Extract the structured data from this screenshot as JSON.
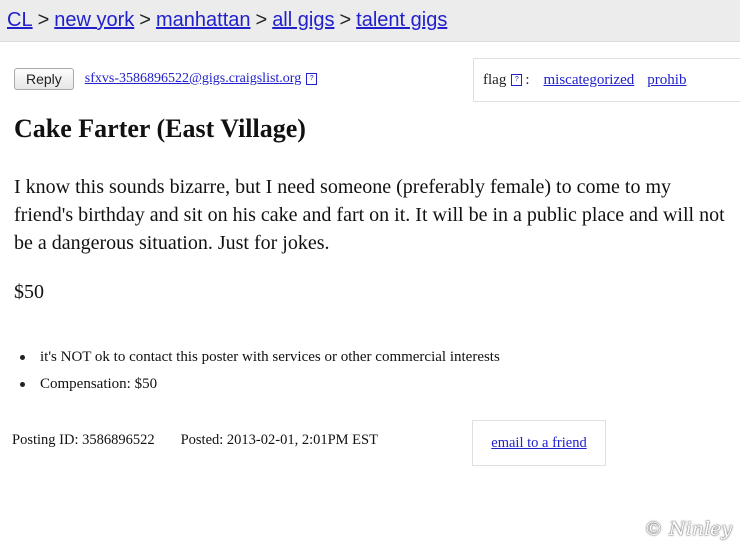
{
  "breadcrumb": {
    "items": [
      "CL",
      "new york",
      "manhattan",
      "all gigs",
      "talent gigs"
    ],
    "separator": ">"
  },
  "reply": {
    "button_label": "Reply",
    "email": "sfxvs-3586896522@gigs.craigslist.org",
    "help_glyph": "?"
  },
  "flag": {
    "label": "flag",
    "help_glyph": "?",
    "colon": ":",
    "options": [
      "miscategorized",
      "prohib"
    ]
  },
  "post": {
    "title": "Cake Farter (East Village)",
    "body": "I know this sounds bizarre, but I need someone (preferably female) to come to my friend's birthday and sit on his cake and fart on it. It will be in a public place and will not be a dangerous situation. Just for jokes.",
    "price": "$50"
  },
  "notices": [
    "it's NOT ok to contact this poster with services or other commercial interests",
    "Compensation: $50"
  ],
  "meta": {
    "posting_id": "Posting ID: 3586896522",
    "posted": "Posted: 2013-02-01, 2:01PM EST",
    "email_friend": "email to a friend"
  },
  "watermark": "© Ninley"
}
